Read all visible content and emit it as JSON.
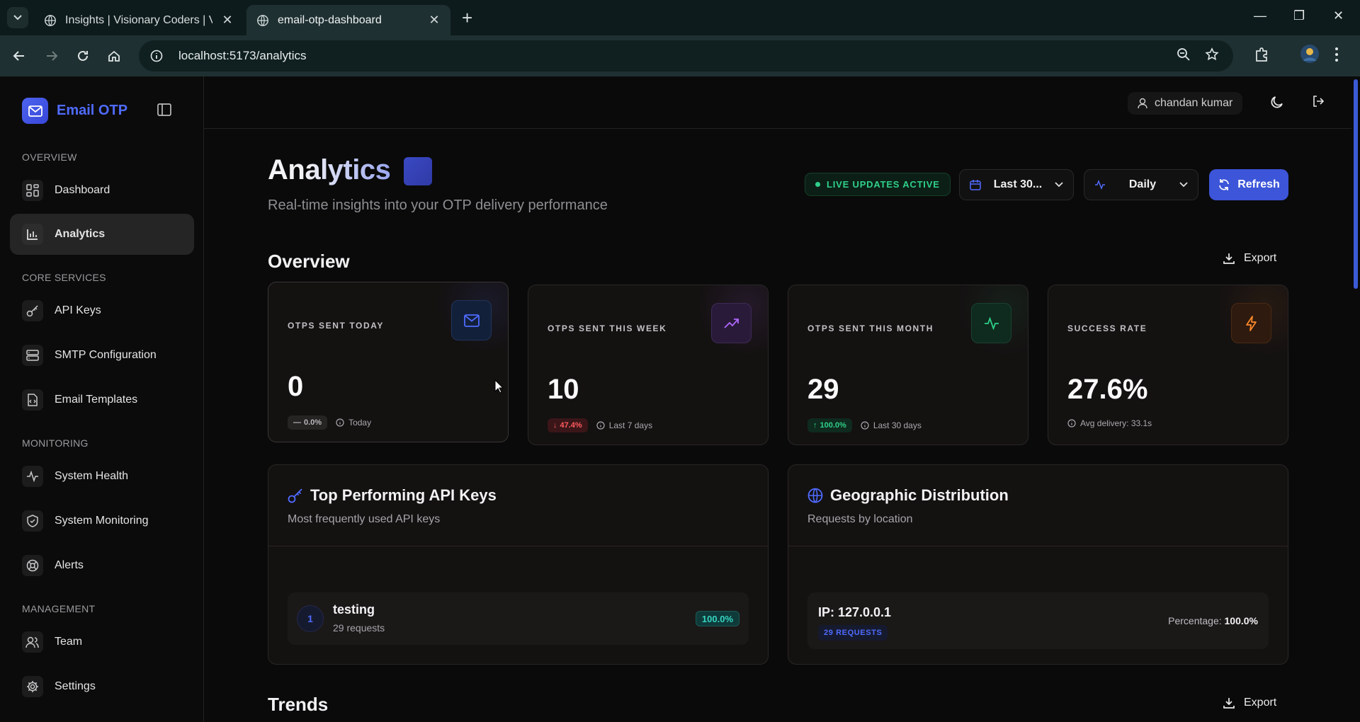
{
  "browser": {
    "tabs": [
      {
        "title": "Insights | Visionary Coders | Visi",
        "active": false
      },
      {
        "title": "email-otp-dashboard",
        "active": true
      }
    ],
    "url": "localhost:5173/analytics"
  },
  "sidebar": {
    "brand": "Email OTP",
    "sections": {
      "overview": "OVERVIEW",
      "core": "CORE SERVICES",
      "monitoring": "MONITORING",
      "management": "MANAGEMENT"
    },
    "items": {
      "dashboard": "Dashboard",
      "analytics": "Analytics",
      "api_keys": "API Keys",
      "smtp": "SMTP Configuration",
      "templates": "Email Templates",
      "system_health": "System Health",
      "system_monitoring": "System Monitoring",
      "alerts": "Alerts",
      "team": "Team",
      "settings": "Settings"
    }
  },
  "header": {
    "user": "chandan kumar"
  },
  "page": {
    "title": "Analytics",
    "subtitle": "Real-time insights into your OTP delivery performance",
    "live_badge": "LIVE UPDATES ACTIVE",
    "range_select": "Last 30...",
    "interval_select": "Daily",
    "refresh": "Refresh",
    "export": "Export"
  },
  "overview": {
    "heading": "Overview",
    "stats": [
      {
        "label": "OTPS SENT TODAY",
        "value": "0",
        "change": "0.0%",
        "period": "Today",
        "trend": "flat",
        "icon": "mail-icon",
        "color": "#4f6bff"
      },
      {
        "label": "OTPS SENT THIS WEEK",
        "value": "10",
        "change": "47.4%",
        "period": "Last 7 days",
        "trend": "down",
        "icon": "trending-up-icon",
        "color": "#b068ff"
      },
      {
        "label": "OTPS SENT THIS MONTH",
        "value": "29",
        "change": "100.0%",
        "period": "Last 30 days",
        "trend": "up",
        "icon": "activity-icon",
        "color": "#2fd08a"
      },
      {
        "label": "SUCCESS RATE",
        "value": "27.6%",
        "change": "",
        "period": "Avg delivery: 33.1s",
        "trend": "none",
        "icon": "zap-icon",
        "color": "#ff8a2a"
      }
    ]
  },
  "api_keys": {
    "title": "Top Performing API Keys",
    "subtitle": "Most frequently used API keys",
    "rows": [
      {
        "rank": "1",
        "name": "testing",
        "requests": "29 requests",
        "share": "100.0%"
      }
    ]
  },
  "geo": {
    "title": "Geographic Distribution",
    "subtitle": "Requests by location",
    "rows": [
      {
        "ip": "IP: 127.0.0.1",
        "requests": "29 REQUESTS",
        "percentage_label": "Percentage:",
        "percentage": "100.0%"
      }
    ]
  },
  "trends": {
    "heading": "Trends",
    "export": "Export"
  }
}
